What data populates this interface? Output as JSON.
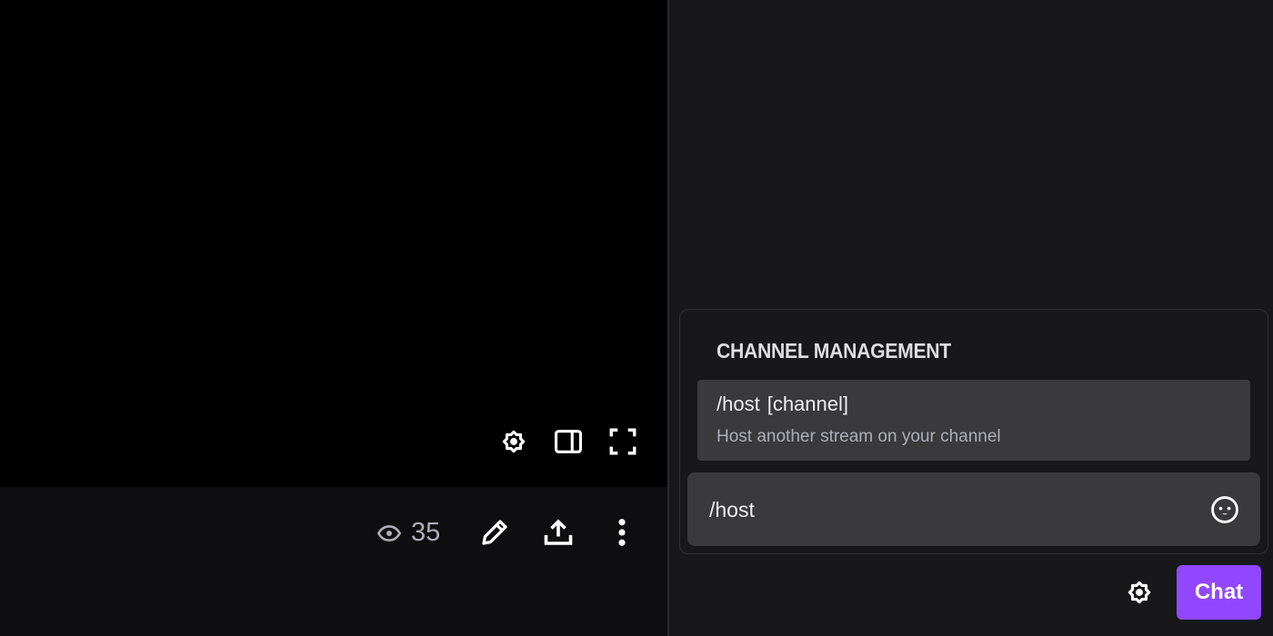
{
  "player": {
    "controls": [
      {
        "name": "settings",
        "icon": "gear-icon"
      },
      {
        "name": "theatre-mode",
        "icon": "sidebar-layout-icon"
      },
      {
        "name": "fullscreen",
        "icon": "fullscreen-icon"
      }
    ]
  },
  "info_bar": {
    "viewer_count": "35",
    "viewer_icon": "eye-icon",
    "actions": [
      {
        "name": "edit",
        "icon": "pencil-icon"
      },
      {
        "name": "share",
        "icon": "share-upload-icon"
      },
      {
        "name": "more",
        "icon": "more-vertical-icon"
      }
    ]
  },
  "chat": {
    "suggestions_section_title": "CHANNEL MANAGEMENT",
    "suggestion": {
      "command": "/host",
      "argument": "[channel]",
      "description": "Host another stream on your channel"
    },
    "input_value": "/host",
    "emote_icon": "emote-smiley-icon",
    "settings_icon": "gear-icon",
    "send_label": "Chat",
    "accent_color": "#9147ff"
  }
}
